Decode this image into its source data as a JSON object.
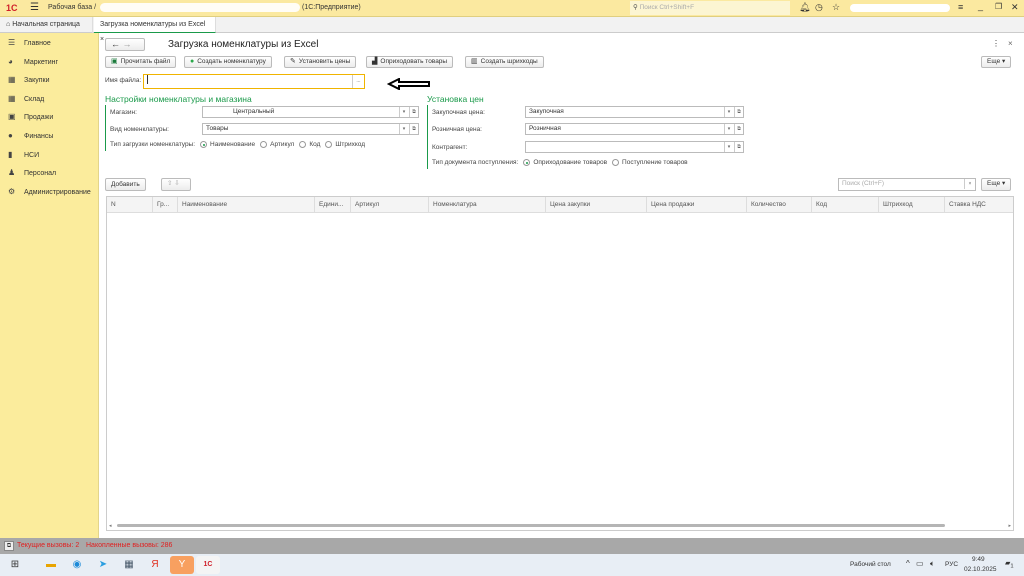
{
  "titlebar": {
    "logo": "1С",
    "title": "Рабочая база /",
    "title_suffix": "(1С:Предприятие)",
    "search_placeholder": "Поиск Ctrl+Shift+F"
  },
  "tabs": [
    {
      "label": "Начальная страница"
    },
    {
      "label": "Загрузка номенклатуры из Excel"
    }
  ],
  "sidebar": {
    "items": [
      {
        "label": "Главное",
        "icon": "menu-icon"
      },
      {
        "label": "Маркетинг",
        "icon": "marketing-icon"
      },
      {
        "label": "Закупки",
        "icon": "cart-icon"
      },
      {
        "label": "Склад",
        "icon": "warehouse-icon"
      },
      {
        "label": "Продажи",
        "icon": "basket-icon"
      },
      {
        "label": "Финансы",
        "icon": "finance-icon"
      },
      {
        "label": "НСИ",
        "icon": "books-icon"
      },
      {
        "label": "Персонал",
        "icon": "person-icon"
      },
      {
        "label": "Администрирование",
        "icon": "gear-icon"
      }
    ]
  },
  "form": {
    "title": "Загрузка номенклатуры из Excel",
    "toolbar": {
      "read_file": "Прочитать файл",
      "create_items": "Создать номенклатуру",
      "set_prices": "Установить цены",
      "receive_goods": "Оприходовать товары",
      "create_barcodes": "Создать шрихкоды",
      "more": "Еще"
    },
    "file_label": "Имя файла:",
    "file_value": "",
    "file_button": "...",
    "left_section": {
      "title": "Настройки номенклатуры и магазина",
      "shop_label": "Магазин:",
      "shop_value": "Центральный",
      "kind_label": "Вид номенклатуры:",
      "kind_value": "Товары",
      "load_type_label": "Тип загрузки номенклатуры:",
      "load_type_options": [
        "Наименование",
        "Артикул",
        "Код",
        "Штрихкод"
      ],
      "load_type_selected": "Наименование"
    },
    "right_section": {
      "title": "Установка цен",
      "purchase_label": "Закупочная цена:",
      "purchase_value": "Закупочная",
      "retail_label": "Розничная цена:",
      "retail_value": "Розничная",
      "partner_label": "Контрагент:",
      "partner_value": "",
      "doc_type_label": "Тип документа поступления:",
      "doc_type_options": [
        "Оприходование товаров",
        "Поступление товаров"
      ],
      "doc_type_selected": "Оприходование товаров"
    },
    "table_toolbar": {
      "add": "Добавить",
      "search_placeholder": "Поиск (Ctrl+F)",
      "clear": "×",
      "more": "Еще"
    },
    "table": {
      "columns": [
        "N",
        "Гр...",
        "Наименование",
        "Едини...",
        "Артикул",
        "Номенклатура",
        "Цена закупки",
        "Цена продажи",
        "Количество",
        "Код",
        "Штрихкод",
        "Ставка НДС"
      ],
      "rows": []
    }
  },
  "statusbar": {
    "current_calls": "Текущие вызовы: 2",
    "accumulated_calls": "Накопленные вызовы: 286"
  },
  "taskbar": {
    "desktop": "Рабочий стол",
    "lang": "РУС",
    "time": "9:49",
    "date": "02.10.2025",
    "notifications": "1"
  },
  "colors": {
    "accent": "#1a9a4a",
    "sidebar": "#fbec9c",
    "topbar": "#fbe9a0",
    "status_text": "#e02020"
  }
}
